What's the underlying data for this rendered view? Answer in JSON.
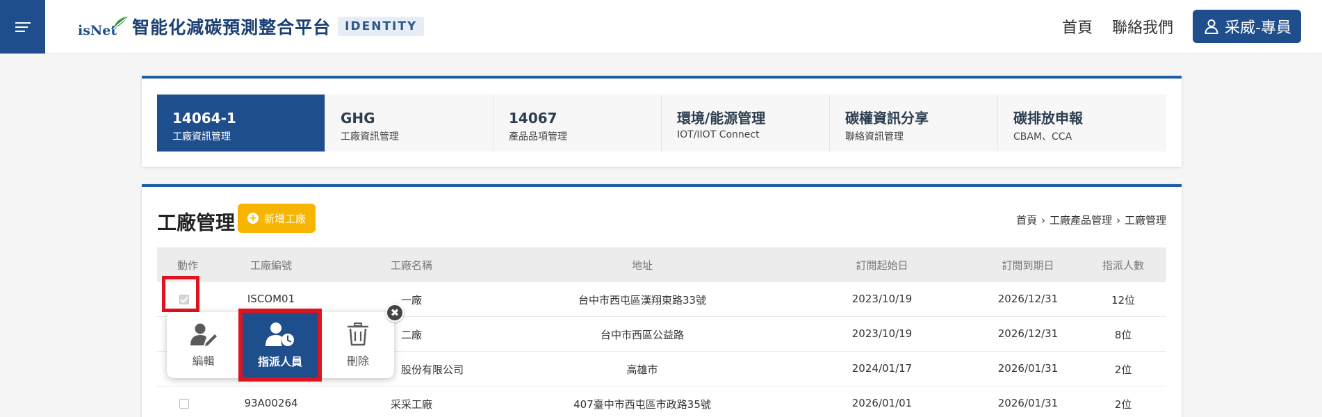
{
  "header": {
    "logo_text": "isNet",
    "brand_title": "智能化減碳預測整合平台",
    "badge": "IDENTITY",
    "nav_home": "首頁",
    "nav_contact": "聯絡我們",
    "user_label": "采威-專員",
    "colors": {
      "primary": "#1f4e8c",
      "accent_yellow": "#f7b500",
      "highlight_red": "#e0141e"
    }
  },
  "modules": [
    {
      "title": "14064-1",
      "subtitle": "工廠資訊管理",
      "active": true
    },
    {
      "title": "GHG",
      "subtitle": "工廠資訊管理",
      "active": false
    },
    {
      "title": "14067",
      "subtitle": "產品品項管理",
      "active": false
    },
    {
      "title": "環境/能源管理",
      "subtitle": "IOT/IIOT Connect",
      "active": false
    },
    {
      "title": "碳權資訊分享",
      "subtitle": "聯絡資訊管理",
      "active": false
    },
    {
      "title": "碳排放申報",
      "subtitle": "CBAM、CCA",
      "active": false
    }
  ],
  "factory": {
    "title": "工廠管理",
    "add_button": "新增工廠",
    "breadcrumb": [
      "首頁",
      "工廠產品管理",
      "工廠管理"
    ],
    "columns": [
      "動作",
      "工廠編號",
      "工廠名稱",
      "地址",
      "訂閱起始日",
      "訂閱到期日",
      "指派人數"
    ],
    "rows": [
      {
        "checked": true,
        "id": "ISCOM01",
        "name": "一廠",
        "address": "台中市西屯區漢翔東路33號",
        "start": "2023/10/19",
        "end": "2026/12/31",
        "count": "12位"
      },
      {
        "checked": false,
        "id": "",
        "name": "二廠",
        "address": "台中市西區公益路",
        "start": "2023/10/19",
        "end": "2026/12/31",
        "count": "8位"
      },
      {
        "checked": false,
        "id": "",
        "name": "股份有限公司",
        "address": "高雄市",
        "start": "2024/01/17",
        "end": "2026/01/31",
        "count": "2位"
      },
      {
        "checked": false,
        "id": "93A00264",
        "name": "采采工廠",
        "address": "407臺中市西屯區市政路35號",
        "start": "2026/01/01",
        "end": "2026/01/31",
        "count": "2位"
      }
    ]
  },
  "popup": {
    "edit": "編輯",
    "assign": "指派人員",
    "delete": "刪除",
    "close_glyph": "✖"
  }
}
